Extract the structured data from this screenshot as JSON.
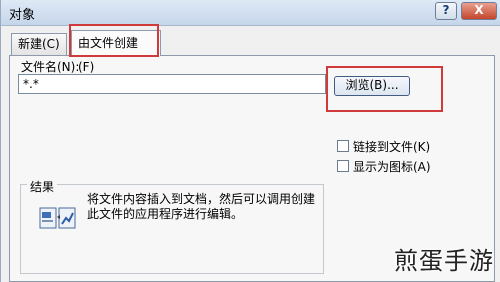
{
  "window": {
    "title": "对象",
    "help_label": "?",
    "close_label": "X"
  },
  "tabs": [
    {
      "label": "新建(C)"
    },
    {
      "label": "由文件创建(F)"
    }
  ],
  "file": {
    "label": "文件名(N):",
    "value": "*.*",
    "browse_label": "浏览(B)..."
  },
  "options": {
    "link_label": "链接到文件(K)",
    "icon_label": "显示为图标(A)"
  },
  "result": {
    "title": "结果",
    "text": "将文件内容插入到文档，然后可以调用创建此文件的应用程序进行编辑。"
  },
  "watermark": "煎蛋手游",
  "colors": {
    "highlight": "#d03a3a",
    "titlebar": "#c6d6ea",
    "close_button": "#c4452c"
  }
}
